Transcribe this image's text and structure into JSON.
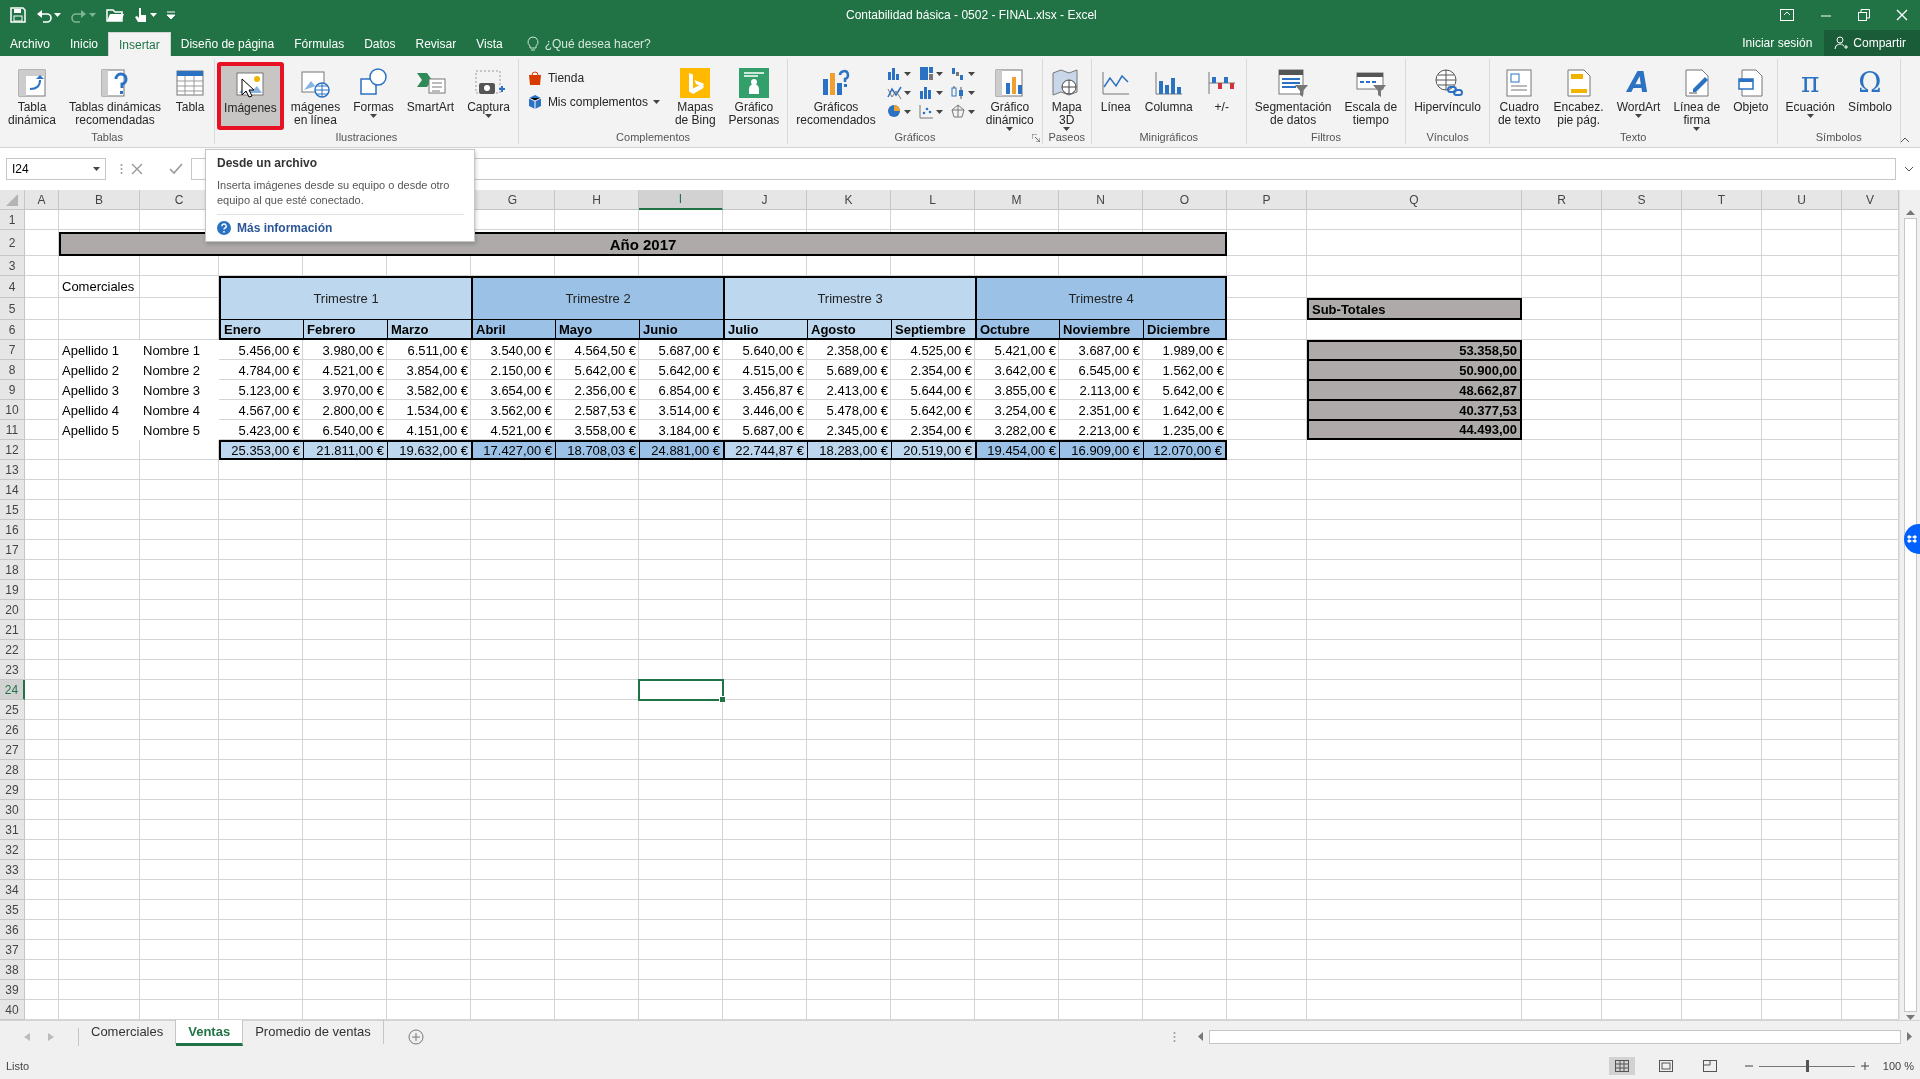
{
  "title_bar": {
    "title": "Contabilidad básica - 0502 - FINAL.xlsx - Excel"
  },
  "ribbon_tabs": [
    {
      "label": "Archivo",
      "selected": false
    },
    {
      "label": "Inicio",
      "selected": false
    },
    {
      "label": "Insertar",
      "selected": true
    },
    {
      "label": "Diseño de página",
      "selected": false
    },
    {
      "label": "Fórmulas",
      "selected": false
    },
    {
      "label": "Datos",
      "selected": false
    },
    {
      "label": "Revisar",
      "selected": false
    },
    {
      "label": "Vista",
      "selected": false
    }
  ],
  "tell_me": {
    "placeholder": "¿Qué desea hacer?"
  },
  "account": {
    "sign_in": "Iniciar sesión",
    "share": "Compartir"
  },
  "ribbon_groups": [
    {
      "label": "Tablas",
      "launcher": false,
      "buttons": [
        {
          "kind": "large",
          "label": "Tabla\ndinámica",
          "dropdown": false,
          "highlighted": false
        },
        {
          "kind": "large",
          "label": "Tablas dinámicas\nrecomendadas",
          "dropdown": false,
          "highlighted": false
        },
        {
          "kind": "large",
          "label": "Tabla",
          "dropdown": false,
          "highlighted": false
        }
      ]
    },
    {
      "label": "Ilustraciones",
      "launcher": false,
      "buttons": [
        {
          "kind": "large",
          "label": "Imágenes",
          "dropdown": false,
          "highlighted": true
        },
        {
          "kind": "large",
          "label": "mágenes\nen línea",
          "dropdown": false,
          "highlighted": false
        },
        {
          "kind": "large",
          "label": "Formas",
          "dropdown": true,
          "highlighted": false
        },
        {
          "kind": "large",
          "label": "SmartArt",
          "dropdown": false,
          "highlighted": false
        },
        {
          "kind": "large",
          "label": "Captura",
          "dropdown": true,
          "highlighted": false
        }
      ]
    },
    {
      "label": "Complementos",
      "launcher": false,
      "buttons": [
        {
          "kind": "small",
          "label": "Tienda",
          "dropdown": false,
          "highlighted": false
        },
        {
          "kind": "small",
          "label": "Mis complementos",
          "dropdown": true,
          "highlighted": false
        },
        {
          "kind": "large",
          "label": "Mapas\nde Bing",
          "dropdown": false,
          "highlighted": false
        },
        {
          "kind": "large",
          "label": "Gráfico\nPersonas",
          "dropdown": false,
          "highlighted": false
        }
      ]
    },
    {
      "label": "Gráficos",
      "launcher": true,
      "buttons": [
        {
          "kind": "large",
          "label": "Gráficos\nrecomendados",
          "dropdown": false,
          "highlighted": false
        },
        {
          "kind": "gallery"
        },
        {
          "kind": "large",
          "label": "Gráfico\ndinámico",
          "dropdown": true,
          "highlighted": false
        }
      ]
    },
    {
      "label": "Paseos",
      "launcher": false,
      "buttons": [
        {
          "kind": "large",
          "label": "Mapa\n3D",
          "dropdown": true,
          "highlighted": false
        }
      ]
    },
    {
      "label": "Minigráficos",
      "launcher": false,
      "buttons": [
        {
          "kind": "large",
          "label": "Línea",
          "dropdown": false,
          "highlighted": false
        },
        {
          "kind": "large",
          "label": "Columna",
          "dropdown": false,
          "highlighted": false
        },
        {
          "kind": "large",
          "label": "+/-",
          "dropdown": false,
          "highlighted": false
        }
      ]
    },
    {
      "label": "Filtros",
      "launcher": false,
      "buttons": [
        {
          "kind": "large",
          "label": "Segmentación\nde datos",
          "dropdown": false,
          "highlighted": false
        },
        {
          "kind": "large",
          "label": "Escala de\ntiempo",
          "dropdown": false,
          "highlighted": false
        }
      ]
    },
    {
      "label": "Vínculos",
      "launcher": false,
      "buttons": [
        {
          "kind": "large",
          "label": "Hipervínculo",
          "dropdown": false,
          "highlighted": false
        }
      ]
    },
    {
      "label": "Texto",
      "launcher": false,
      "buttons": [
        {
          "kind": "large",
          "label": "Cuadro\nde texto",
          "dropdown": false,
          "highlighted": false
        },
        {
          "kind": "large",
          "label": "Encabez.\npie pág.",
          "dropdown": false,
          "highlighted": false
        },
        {
          "kind": "large",
          "glyph": "A",
          "label": "WordArt",
          "dropdown": true,
          "highlighted": false
        },
        {
          "kind": "large",
          "label": "Línea de\nfirma",
          "dropdown": true,
          "highlighted": false
        },
        {
          "kind": "large",
          "label": "Objeto",
          "dropdown": false,
          "highlighted": false
        }
      ]
    },
    {
      "label": "Símbolos",
      "launcher": false,
      "buttons": [
        {
          "kind": "large",
          "glyph": "π",
          "label": "Ecuación",
          "dropdown": true,
          "highlighted": false
        },
        {
          "kind": "large",
          "glyph": "Ω",
          "label": "Símbolo",
          "dropdown": false,
          "highlighted": false
        }
      ]
    }
  ],
  "tooltip": {
    "title": "Desde un archivo",
    "text": "Inserta imágenes desde su equipo o desde otro equipo al que esté conectado.",
    "link": "Más información"
  },
  "formula_bar": {
    "name_box": "I24"
  },
  "sheet": {
    "columns": [
      {
        "letter": "A",
        "selected": false
      },
      {
        "letter": "B",
        "selected": false
      },
      {
        "letter": "C",
        "selected": false
      },
      {
        "letter": "G",
        "selected": false
      },
      {
        "letter": "H",
        "selected": false
      },
      {
        "letter": "I",
        "selected": true
      },
      {
        "letter": "J",
        "selected": false
      },
      {
        "letter": "K",
        "selected": false
      },
      {
        "letter": "L",
        "selected": false
      },
      {
        "letter": "M",
        "selected": false
      },
      {
        "letter": "N",
        "selected": false
      },
      {
        "letter": "O",
        "selected": false
      },
      {
        "letter": "P",
        "selected": false
      },
      {
        "letter": "Q",
        "selected": false
      },
      {
        "letter": "R",
        "selected": false
      },
      {
        "letter": "S",
        "selected": false
      },
      {
        "letter": "T",
        "selected": false
      },
      {
        "letter": "U",
        "selected": false
      },
      {
        "letter": "V",
        "selected": false
      }
    ],
    "rows": [
      {
        "number": "1",
        "selected": false
      },
      {
        "number": "2",
        "selected": false
      },
      {
        "number": "3",
        "selected": false
      },
      {
        "number": "4",
        "selected": false
      },
      {
        "number": "5",
        "selected": false
      },
      {
        "number": "6",
        "selected": false
      },
      {
        "number": "7",
        "selected": false
      },
      {
        "number": "8",
        "selected": false
      },
      {
        "number": "9",
        "selected": false
      },
      {
        "number": "10",
        "selected": false
      },
      {
        "number": "11",
        "selected": false
      },
      {
        "number": "12",
        "selected": false
      },
      {
        "number": "13",
        "selected": false
      },
      {
        "number": "14",
        "selected": false
      },
      {
        "number": "15",
        "selected": false
      },
      {
        "number": "16",
        "selected": false
      },
      {
        "number": "17",
        "selected": false
      },
      {
        "number": "18",
        "selected": false
      },
      {
        "number": "19",
        "selected": false
      },
      {
        "number": "20",
        "selected": false
      },
      {
        "number": "21",
        "selected": false
      },
      {
        "number": "22",
        "selected": false
      },
      {
        "number": "23",
        "selected": false
      },
      {
        "number": "24",
        "selected": true
      },
      {
        "number": "25",
        "selected": false
      },
      {
        "number": "26",
        "selected": false
      },
      {
        "number": "27",
        "selected": false
      },
      {
        "number": "28",
        "selected": false
      },
      {
        "number": "29",
        "selected": false
      },
      {
        "number": "30",
        "selected": false
      },
      {
        "number": "31",
        "selected": false
      },
      {
        "number": "32",
        "selected": false
      },
      {
        "number": "33",
        "selected": false
      },
      {
        "number": "34",
        "selected": false
      },
      {
        "number": "35",
        "selected": false
      },
      {
        "number": "36",
        "selected": false
      },
      {
        "number": "37",
        "selected": false
      },
      {
        "number": "38",
        "selected": false
      },
      {
        "number": "39",
        "selected": false
      },
      {
        "number": "40",
        "selected": false
      }
    ],
    "report": {
      "title": "Año 2017",
      "label": "Comerciales",
      "quarters": [
        {
          "name": "Trimestre 1",
          "color": "#bdd7ee",
          "months": [
            "Enero",
            "Febrero",
            "Marzo"
          ]
        },
        {
          "name": "Trimestre 2",
          "color": "#9bc2e6",
          "months": [
            "Abril",
            "Mayo",
            "Junio"
          ]
        },
        {
          "name": "Trimestre 3",
          "color": "#bdd7ee",
          "months": [
            "Julio",
            "Agosto",
            "Septiembre"
          ]
        },
        {
          "name": "Trimestre 4",
          "color": "#9bc2e6",
          "months": [
            "Octubre",
            "Noviembre",
            "Diciembre"
          ]
        }
      ],
      "people": [
        {
          "surname": "Apellido 1",
          "name": "Nombre 1",
          "values": [
            "5.456,00 €",
            "3.980,00 €",
            "6.511,00 €",
            "3.540,00 €",
            "4.564,50 €",
            "5.687,00 €",
            "5.640,00 €",
            "2.358,00 €",
            "4.525,00 €",
            "5.421,00 €",
            "3.687,00 €",
            "1.989,00 €"
          ]
        },
        {
          "surname": "Apellido 2",
          "name": "Nombre 2",
          "values": [
            "4.784,00 €",
            "4.521,00 €",
            "3.854,00 €",
            "2.150,00 €",
            "5.642,00 €",
            "5.642,00 €",
            "4.515,00 €",
            "5.689,00 €",
            "2.354,00 €",
            "3.642,00 €",
            "6.545,00 €",
            "1.562,00 €"
          ]
        },
        {
          "surname": "Apellido 3",
          "name": "Nombre 3",
          "values": [
            "5.123,00 €",
            "3.970,00 €",
            "3.582,00 €",
            "3.654,00 €",
            "2.356,00 €",
            "6.854,00 €",
            "3.456,87 €",
            "2.413,00 €",
            "5.644,00 €",
            "3.855,00 €",
            "2.113,00 €",
            "5.642,00 €"
          ]
        },
        {
          "surname": "Apellido 4",
          "name": "Nombre 4",
          "values": [
            "4.567,00 €",
            "2.800,00 €",
            "1.534,00 €",
            "3.562,00 €",
            "2.587,53 €",
            "3.514,00 €",
            "3.446,00 €",
            "5.478,00 €",
            "5.642,00 €",
            "3.254,00 €",
            "2.351,00 €",
            "1.642,00 €"
          ]
        },
        {
          "surname": "Apellido 5",
          "name": "Nombre 5",
          "values": [
            "5.423,00 €",
            "6.540,00 €",
            "4.151,00 €",
            "4.521,00 €",
            "3.558,00 €",
            "3.184,00 €",
            "5.687,00 €",
            "2.345,00 €",
            "2.354,00 €",
            "3.282,00 €",
            "2.213,00 €",
            "1.235,00 €"
          ]
        }
      ],
      "totals": [
        "25.353,00 €",
        "21.811,00 €",
        "19.632,00 €",
        "17.427,00 €",
        "18.708,03 €",
        "24.881,00 €",
        "22.744,87 €",
        "18.283,00 €",
        "20.519,00 €",
        "19.454,00 €",
        "16.909,00 €",
        "12.070,00 €"
      ],
      "subtotals": {
        "title": "Sub-Totales",
        "values": [
          "53.358,50",
          "50.900,00",
          "48.662,87",
          "40.377,53",
          "44.493,00"
        ]
      }
    }
  },
  "sheet_tabs": [
    {
      "label": "Comerciales",
      "selected": false
    },
    {
      "label": "Ventas",
      "selected": true
    },
    {
      "label": "Promedio de ventas",
      "selected": false
    }
  ],
  "status_bar": {
    "text": "Listo",
    "zoom": {
      "level": 0.5,
      "reading": "100 %"
    }
  }
}
